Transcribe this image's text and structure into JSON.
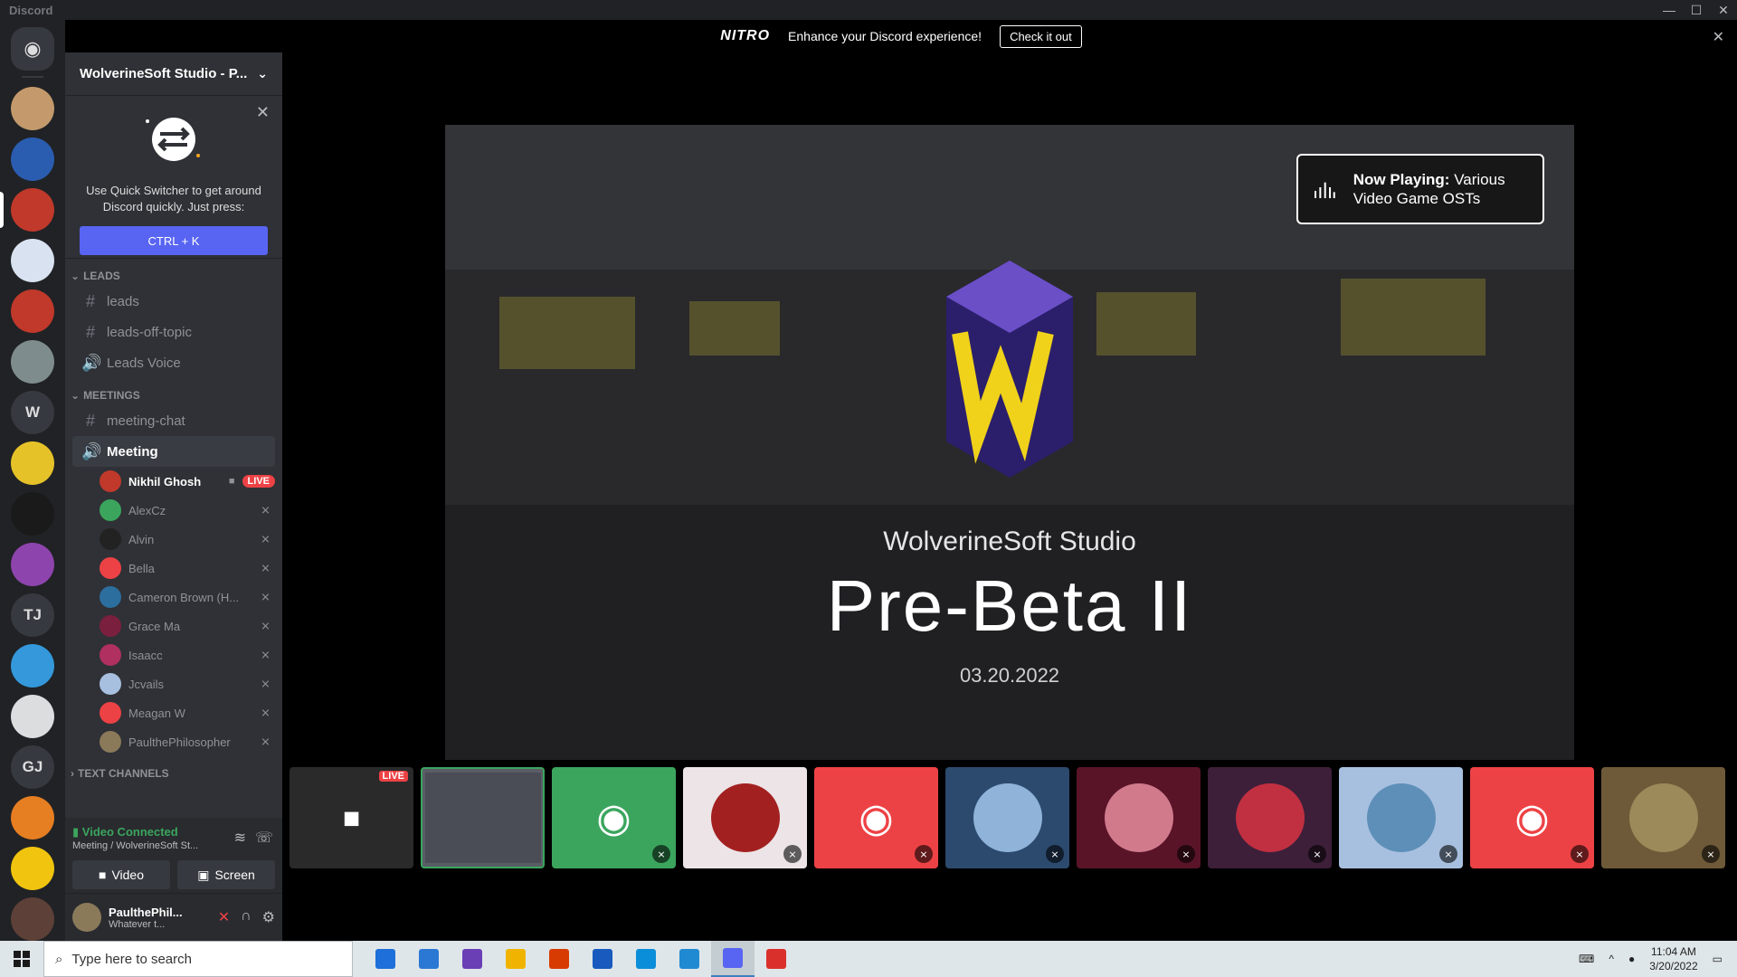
{
  "window": {
    "app_name": "Discord",
    "controls": [
      "—",
      "☐",
      "✕"
    ]
  },
  "nitro": {
    "logo": "NITRO",
    "message": "Enhance your Discord experience!",
    "cta": "Check it out",
    "close": "✕"
  },
  "servers": [
    {
      "kind": "home"
    },
    {
      "kind": "avatar",
      "color": "#c49a6c"
    },
    {
      "kind": "avatar",
      "color": "#2a5db0"
    },
    {
      "kind": "avatar",
      "color": "#c0392b",
      "active": true
    },
    {
      "kind": "avatar",
      "color": "#d8e2f0"
    },
    {
      "kind": "avatar",
      "color": "#c0392b"
    },
    {
      "kind": "avatar",
      "color": "#7f8c8d"
    },
    {
      "kind": "letter",
      "text": "W"
    },
    {
      "kind": "avatar",
      "color": "#e6c229"
    },
    {
      "kind": "avatar",
      "color": "#1a1a1a"
    },
    {
      "kind": "avatar",
      "color": "#8e44ad"
    },
    {
      "kind": "letter",
      "text": "TJ"
    },
    {
      "kind": "avatar",
      "color": "#3498db"
    },
    {
      "kind": "avatar",
      "color": "#dcddde"
    },
    {
      "kind": "letter",
      "text": "GJ"
    },
    {
      "kind": "avatar",
      "color": "#e67e22"
    },
    {
      "kind": "avatar",
      "color": "#f1c40f"
    },
    {
      "kind": "avatar",
      "color": "#5d4037"
    }
  ],
  "guild": {
    "name": "WolverineSoft Studio - P..."
  },
  "quick_switcher": {
    "line1": "Use Quick Switcher to get around",
    "line2": "Discord quickly. Just press:",
    "shortcut": "CTRL + K",
    "close": "✕"
  },
  "categories": {
    "leads": "LEADS",
    "meetings": "MEETINGS",
    "text": "TEXT CHANNELS"
  },
  "leads_channels": [
    {
      "icon": "#",
      "label": "leads"
    },
    {
      "icon": "#",
      "label": "leads-off-topic"
    },
    {
      "icon": "🔊",
      "label": "Leads Voice"
    }
  ],
  "meeting_channels": [
    {
      "icon": "#",
      "label": "meeting-chat"
    },
    {
      "icon": "🔊",
      "label": "Meeting"
    }
  ],
  "voice_users": [
    {
      "name": "Nikhil Ghosh",
      "avatar_color": "#c0392b",
      "live": "LIVE",
      "self": true
    },
    {
      "name": "AlexCz",
      "avatar_color": "#3ba55d"
    },
    {
      "name": "Alvin",
      "avatar_color": "#222222"
    },
    {
      "name": "Bella",
      "avatar_color": "#ed4245"
    },
    {
      "name": "Cameron Brown (H...",
      "avatar_color": "#2c6e9e"
    },
    {
      "name": "Grace Ma",
      "avatar_color": "#7a1f3d"
    },
    {
      "name": "Isaacc",
      "avatar_color": "#b03060"
    },
    {
      "name": "Jcvails",
      "avatar_color": "#a8c0e0"
    },
    {
      "name": "Meagan W",
      "avatar_color": "#ed4245"
    },
    {
      "name": "PaulthePhilosopher",
      "avatar_color": "#8a7a5a"
    }
  ],
  "voice_panel": {
    "status": "Video Connected",
    "location": "Meeting / WolverineSoft St...",
    "video_label": "Video",
    "screen_label": "Screen"
  },
  "user_panel": {
    "name": "PaulthePhil...",
    "status": "Whatever t..."
  },
  "stream": {
    "now_playing_label": "Now Playing:",
    "now_playing_value": "Various Video Game OSTs",
    "studio": "WolverineSoft Studio",
    "event": "Pre-Beta II",
    "date": "03.20.2022"
  },
  "tiles": [
    {
      "kind": "camera",
      "bg": "#2a2a2a",
      "live": "LIVE"
    },
    {
      "kind": "stream",
      "bg": "#5a5d66"
    },
    {
      "kind": "discord",
      "bg": "#3ba55d"
    },
    {
      "kind": "avatar",
      "bg": "#ece4e6",
      "avatar": "#a32020"
    },
    {
      "kind": "discord",
      "bg": "#ed4245"
    },
    {
      "kind": "avatar",
      "bg": "#2c4a6e",
      "avatar": "#8fb3d9"
    },
    {
      "kind": "avatar",
      "bg": "#5a1428",
      "avatar": "#d07a8c"
    },
    {
      "kind": "avatar",
      "bg": "#3d1f3a",
      "avatar": "#c03040"
    },
    {
      "kind": "avatar",
      "bg": "#a8c0e0",
      "avatar": "#5e8fb8"
    },
    {
      "kind": "discord",
      "bg": "#ed4245"
    },
    {
      "kind": "avatar",
      "bg": "#6e5a38",
      "avatar": "#9c8a5a"
    }
  ],
  "taskbar": {
    "search_placeholder": "Type here to search",
    "apps": [
      {
        "color": "#1e6fd9"
      },
      {
        "color": "#2b78d4"
      },
      {
        "color": "#6a3fb5"
      },
      {
        "color": "#f0b400"
      },
      {
        "color": "#d83b01"
      },
      {
        "color": "#185abd"
      },
      {
        "color": "#0b8ed9"
      },
      {
        "color": "#1f8ad2"
      },
      {
        "color": "#5865f2",
        "active": true
      },
      {
        "color": "#d9302c"
      }
    ],
    "time": "11:04 AM",
    "date": "3/20/2022"
  }
}
